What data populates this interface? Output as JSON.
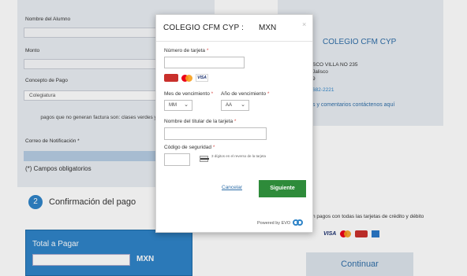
{
  "form": {
    "student_label": "Nombre del Alumno",
    "amount_label": "Monto",
    "concept_label": "Concepto de Pago",
    "concept_value": "Colegiatura",
    "invoice_note": "pagos que no generan factura son: clases verdes y extraescolares.",
    "email_label": "Correo de Notificación *",
    "required_note": "(*) Campos obligatorios"
  },
  "step": {
    "number": "2",
    "title": "Confirmación del pago"
  },
  "total": {
    "label": "Total a Pagar",
    "currency": "MXN"
  },
  "company_panel": {
    "name": "COLEGIO CFM CYP",
    "address_line1": "SCO VILLA NO 235",
    "address_line2": "Jalisco",
    "address_line3": "9",
    "phone": "682-2221",
    "contact": "s y comentarios contáctenos aquí"
  },
  "payment_info": {
    "text": "n pagos con todas las tarjetas de crédito y débito",
    "visa": "VISA",
    "continue_label": "Continuar"
  },
  "modal": {
    "title": "COLEGIO CFM CYP :",
    "currency": "MXN",
    "close": "×",
    "card_number_label": "Número de tarjeta",
    "card_visa": "VISA",
    "expiry_month_label": "Mes de vencimiento",
    "expiry_year_label": "Año de vencimiento",
    "month_value": "MM",
    "year_value": "AA",
    "holder_label": "Nombre del titular de la tarjeta",
    "cvv_label": "Código de seguridad",
    "cvv_hint": "3 dígitos en el reverso de la tarjeta",
    "required_mark": "*",
    "cancel_label": "Cancelar",
    "next_label": "Siguiente",
    "powered_by": "Powered by EVO"
  },
  "colors": {
    "primary_blue": "#2f84c8",
    "next_green": "#2e8b3a",
    "required_red": "#d9534f"
  },
  "icons": [
    "carnet-card-icon",
    "mastercard-icon",
    "visa-card-icon",
    "amex-card-icon",
    "cvv-card-icon",
    "evo-logo-icon",
    "close-icon",
    "chevron-down-icon"
  ]
}
